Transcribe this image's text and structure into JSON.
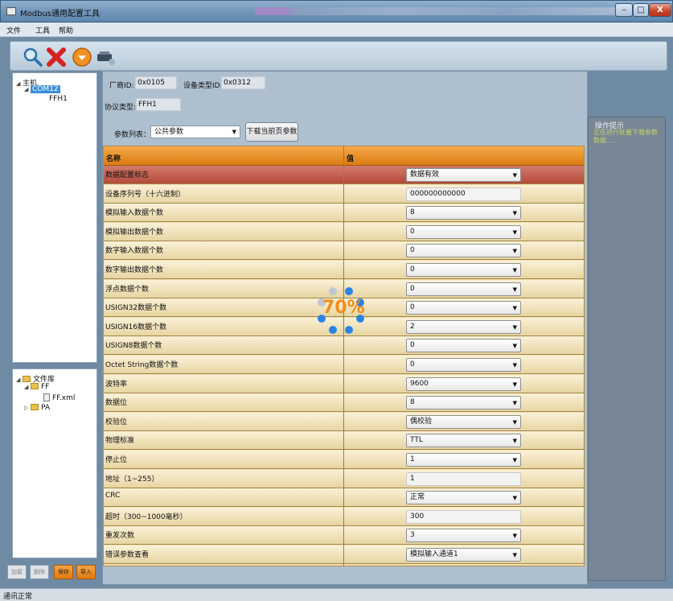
{
  "window": {
    "title": "Modbus通用配置工具",
    "minimize": "‒",
    "maximize": "□",
    "close": "X"
  },
  "menu": [
    "文件",
    "工具",
    "帮助"
  ],
  "toolbar": {
    "icons": [
      "search-icon",
      "delete-icon",
      "download-icon",
      "connect-icon"
    ]
  },
  "tree": {
    "root": "主机",
    "port": "COM12",
    "device": "FFH1"
  },
  "library": {
    "root": "文件库",
    "ff": "FF",
    "file": "FF.xml",
    "pa": "PA"
  },
  "left_buttons": {
    "load": "加载",
    "delete": "删除",
    "save": "保存",
    "import": "导入"
  },
  "device_info": {
    "vendor_label": "厂商ID:",
    "vendor_value": "0x0105",
    "type_label": "设备类型ID:",
    "type_value": "0x0312",
    "protocol_label": "协议类型:",
    "protocol_value": "FFH1"
  },
  "param_list": {
    "label": "参数列表：",
    "selected": "公共参数",
    "download_button": "下载当前页参数"
  },
  "grid": {
    "headers": [
      "名称",
      "值"
    ],
    "rows": [
      {
        "name": "数据配置标志",
        "value": "数据有效",
        "kind": "combo"
      },
      {
        "name": "设备序列号（十六进制）",
        "value": "000000000000",
        "kind": "text"
      },
      {
        "name": "模拟输入数据个数",
        "value": "8",
        "kind": "combo"
      },
      {
        "name": "模拟输出数据个数",
        "value": "0",
        "kind": "combo"
      },
      {
        "name": "数字输入数据个数",
        "value": "0",
        "kind": "combo"
      },
      {
        "name": "数字输出数据个数",
        "value": "0",
        "kind": "combo"
      },
      {
        "name": "浮点数据个数",
        "value": "0",
        "kind": "combo"
      },
      {
        "name": "USIGN32数据个数",
        "value": "0",
        "kind": "combo"
      },
      {
        "name": "USIGN16数据个数",
        "value": "2",
        "kind": "combo"
      },
      {
        "name": "USIGN8数据个数",
        "value": "0",
        "kind": "combo"
      },
      {
        "name": "Octet String数据个数",
        "value": "0",
        "kind": "combo"
      },
      {
        "name": "波特率",
        "value": "9600",
        "kind": "combo"
      },
      {
        "name": "数据位",
        "value": "8",
        "kind": "combo"
      },
      {
        "name": "校验位",
        "value": "偶校验",
        "kind": "combo"
      },
      {
        "name": "物理标准",
        "value": "TTL",
        "kind": "combo"
      },
      {
        "name": "停止位",
        "value": "1",
        "kind": "combo"
      },
      {
        "name": "地址（1~255）",
        "value": "1",
        "kind": "text"
      },
      {
        "name": "CRC",
        "value": "正常",
        "kind": "combo"
      },
      {
        "name": "超时（300~1000毫秒）",
        "value": "300",
        "kind": "text"
      },
      {
        "name": "重发次数",
        "value": "3",
        "kind": "combo"
      },
      {
        "name": "错误参数查看",
        "value": "模拟输入通道1",
        "kind": "combo"
      }
    ]
  },
  "progress": {
    "text": "70%",
    "value": 0.7
  },
  "hint": {
    "title": "操作提示",
    "message": "正在进行批量下载参数数据......"
  },
  "status": "通讯正常"
}
